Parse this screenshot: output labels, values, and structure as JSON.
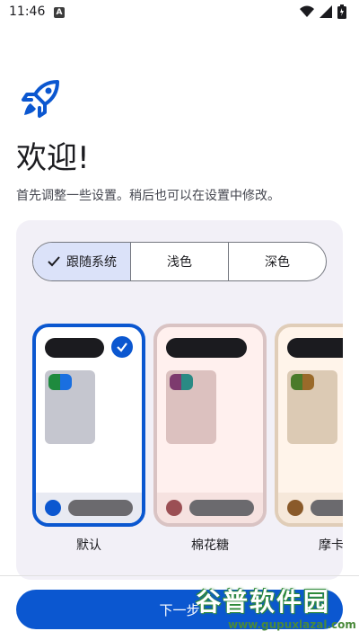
{
  "status": {
    "time": "11:46",
    "notification_letter": "A"
  },
  "header": {
    "icon": "rocket-icon",
    "title": "欢迎!",
    "subtitle": "首先调整一些设置。稍后也可以在设置中修改。"
  },
  "theme_mode": {
    "options": [
      "跟随系统",
      "浅色",
      "深色"
    ],
    "selected": "跟随系统"
  },
  "color_schemes": [
    {
      "label": "默认",
      "selected": true,
      "accent": "#0b57d0",
      "chip_colors": [
        "#1e8a3e",
        "#1a6fe0"
      ]
    },
    {
      "label": "棉花糖",
      "selected": false,
      "accent": "#9b4f54",
      "chip_colors": [
        "#7d3a6e",
        "#2a8a84"
      ]
    },
    {
      "label": "摩卡",
      "selected": false,
      "accent": "#8a5a2a",
      "chip_colors": [
        "#4a7a2a",
        "#9a6a2a"
      ]
    }
  ],
  "footer": {
    "next_label": "下一步"
  },
  "watermark": {
    "text": "谷普软件园",
    "url": "www.gupuxlazal.com"
  },
  "colors": {
    "primary": "#0b57d0",
    "panel_bg": "#f2f0f7"
  }
}
